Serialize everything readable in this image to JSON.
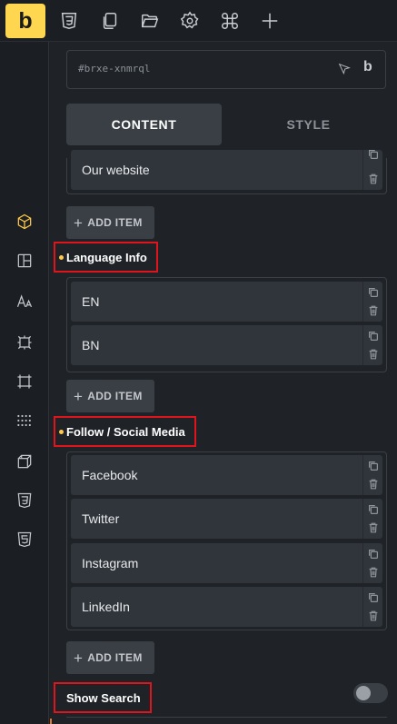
{
  "toolbar": {
    "logo": "b",
    "icons": [
      "css3-icon",
      "pages-icon",
      "folder-icon",
      "settings-icon",
      "command-icon",
      "add-icon"
    ]
  },
  "rail": {
    "icons": [
      "cube-icon",
      "layout-icon",
      "typography-icon",
      "frame-icon",
      "crop-icon",
      "grid-dots-icon",
      "box-3d-icon",
      "css3-icon",
      "html5-icon"
    ]
  },
  "selector": {
    "id": "#brxe-xnmrql",
    "brand": "b"
  },
  "tabs": [
    {
      "label": "CONTENT",
      "active": true
    },
    {
      "label": "STYLE",
      "active": false
    }
  ],
  "sections": {
    "top": {
      "items": [
        {
          "label": "Our website"
        }
      ],
      "add_label": "ADD ITEM"
    },
    "language": {
      "title": "Language Info",
      "items": [
        {
          "label": "EN"
        },
        {
          "label": "BN"
        }
      ],
      "add_label": "ADD ITEM"
    },
    "social": {
      "title": "Follow / Social Media",
      "items": [
        {
          "label": "Facebook"
        },
        {
          "label": "Twitter"
        },
        {
          "label": "Instagram"
        },
        {
          "label": "LinkedIn"
        }
      ],
      "add_label": "ADD ITEM"
    },
    "search": {
      "title": "Show Search",
      "enabled": false
    }
  },
  "colors": {
    "accent": "#ffd64f",
    "highlight_box": "#e0141c",
    "panel_bg": "#1f2328",
    "item_bg": "#30353b"
  }
}
